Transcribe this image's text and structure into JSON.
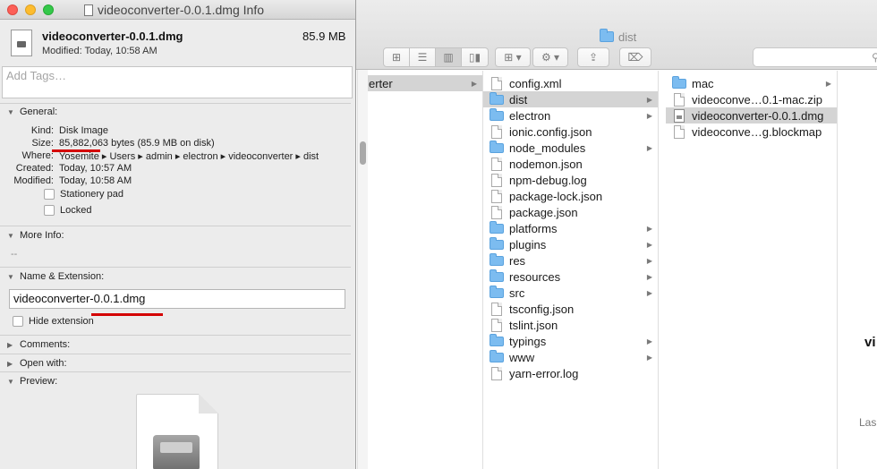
{
  "info": {
    "title": "videoconverter-0.0.1.dmg Info",
    "file_name": "videoconverter-0.0.1.dmg",
    "file_size": "85.9 MB",
    "modified_line": "Modified: Today, 10:58 AM",
    "tags_placeholder": "Add Tags…",
    "general": {
      "header": "General:",
      "kind_label": "Kind:",
      "kind_value": "Disk Image",
      "size_label": "Size:",
      "size_value": "85,882,063 bytes (85.9 MB on disk)",
      "where_label": "Where:",
      "where_value": "Yosemite ▸ Users ▸ admin ▸ electron ▸ videoconverter ▸ dist",
      "created_label": "Created:",
      "created_value": "Today, 10:57 AM",
      "modified_label": "Modified:",
      "modified_value": "Today, 10:58 AM",
      "stationery_label": "Stationery pad",
      "locked_label": "Locked"
    },
    "more_info": {
      "header": "More Info:",
      "value": "--"
    },
    "name_ext": {
      "header": "Name & Extension:",
      "value": "videoconverter-0.0.1.dmg",
      "hide_ext_label": "Hide extension"
    },
    "comments_header": "Comments:",
    "open_with_header": "Open with:",
    "preview_header": "Preview:",
    "annotation_color": "#d40000"
  },
  "finder": {
    "title": "dist",
    "col1": [
      {
        "label": "erter",
        "has_children": true
      }
    ],
    "col2": [
      {
        "label": "config.xml",
        "type": "file"
      },
      {
        "label": "dist",
        "type": "folder",
        "selected": true
      },
      {
        "label": "electron",
        "type": "folder"
      },
      {
        "label": "ionic.config.json",
        "type": "file"
      },
      {
        "label": "node_modules",
        "type": "folder"
      },
      {
        "label": "nodemon.json",
        "type": "file"
      },
      {
        "label": "npm-debug.log",
        "type": "file"
      },
      {
        "label": "package-lock.json",
        "type": "file"
      },
      {
        "label": "package.json",
        "type": "file"
      },
      {
        "label": "platforms",
        "type": "folder"
      },
      {
        "label": "plugins",
        "type": "folder"
      },
      {
        "label": "res",
        "type": "folder"
      },
      {
        "label": "resources",
        "type": "folder"
      },
      {
        "label": "src",
        "type": "folder"
      },
      {
        "label": "tsconfig.json",
        "type": "file"
      },
      {
        "label": "tslint.json",
        "type": "file"
      },
      {
        "label": "typings",
        "type": "folder"
      },
      {
        "label": "www",
        "type": "folder"
      },
      {
        "label": "yarn-error.log",
        "type": "file"
      }
    ],
    "col3": [
      {
        "label": "mac",
        "type": "folder"
      },
      {
        "label": "videoconve…0.1-mac.zip",
        "type": "file"
      },
      {
        "label": "videoconverter-0.0.1.dmg",
        "type": "dmg",
        "selected": true
      },
      {
        "label": "videoconve…g.blockmap",
        "type": "file"
      }
    ],
    "preview_name": "vi",
    "preview_last": "Las"
  }
}
